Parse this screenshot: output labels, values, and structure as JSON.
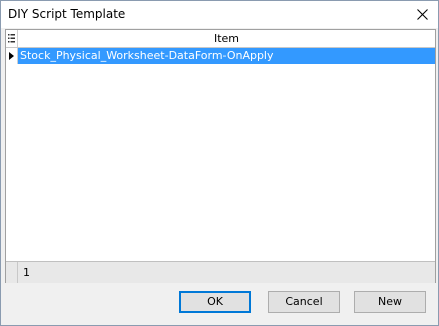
{
  "window": {
    "title": "DIY Script Template",
    "close_icon": "close-icon"
  },
  "grid": {
    "columns": [
      "Item"
    ],
    "rows": [
      {
        "item": "Stock_Physical_Worksheet-DataForm-OnApply",
        "selected": true
      }
    ],
    "footer_count": "1",
    "selection_color": "#3399ff"
  },
  "buttons": {
    "ok_label": "OK",
    "cancel_label": "Cancel",
    "new_label": "New"
  }
}
